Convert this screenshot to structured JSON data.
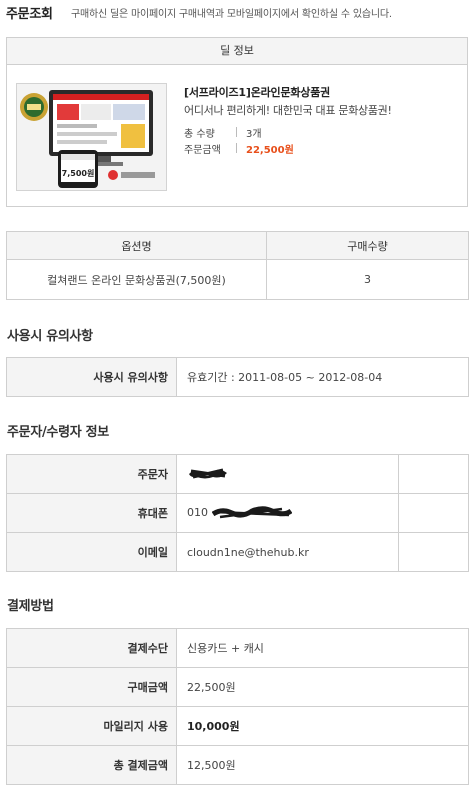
{
  "header": {
    "title": "주문조회",
    "subtitle": "구매하신 딜은 마이페이지 구매내역과 모바일페이지에서 확인하실 수 있습니다."
  },
  "deal": {
    "section_title": "딜 정보",
    "name": "[서프라이즈1]온라인문화상품권",
    "description": "어디서나 편리하게! 대한민국 대표 문화상품권!",
    "quantity_label": "총 수량",
    "quantity_value": "3개",
    "amount_label": "주문금액",
    "amount_value": "22,500원",
    "thumb_price": "7,500원"
  },
  "options": {
    "headers": [
      "옵션명",
      "구매수량"
    ],
    "rows": [
      {
        "name": "컬쳐랜드 온라인 문화상품권(7,500원)",
        "qty": "3"
      }
    ]
  },
  "usage": {
    "title": "사용시 유의사항",
    "label": "사용시 유의사항",
    "value": "유효기간 : 2011-08-05 ~ 2012-08-04"
  },
  "buyer": {
    "title": "주문자/수령자 정보",
    "name_label": "주문자",
    "phone_label": "휴대폰",
    "phone_value": "010",
    "email_label": "이메일",
    "email_value": "cloudn1ne@thehub.kr"
  },
  "payment": {
    "title": "결제방법",
    "method_label": "결제수단",
    "method_value": "신용카드 + 캐시",
    "purchase_label": "구매금액",
    "purchase_value": "22,500원",
    "mileage_label": "마일리지 사용",
    "mileage_value": "10,000원",
    "total_label": "총 결제금액",
    "total_value": "12,500원"
  },
  "colors": {
    "accent": "#e8501c",
    "header_bg": "#f4f4f4",
    "border": "#cfcfcf"
  }
}
